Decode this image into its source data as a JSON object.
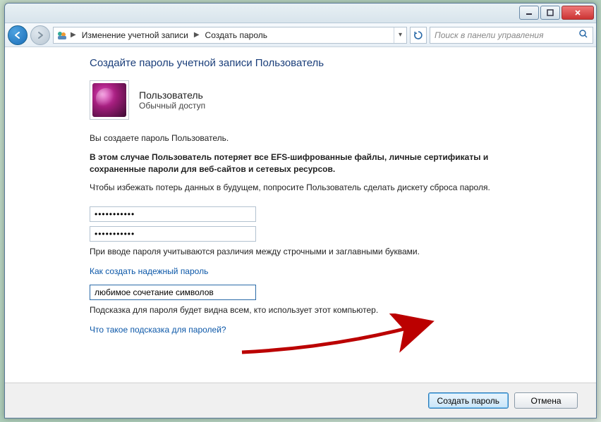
{
  "titlebar": {
    "minimize": "–",
    "maximize": "☐",
    "close": "✕"
  },
  "nav": {
    "breadcrumb1": "Изменение учетной записи",
    "breadcrumb2": "Создать пароль",
    "search_placeholder": "Поиск в панели управления"
  },
  "page": {
    "title": "Создайте пароль учетной записи Пользователь",
    "user_name": "Пользователь",
    "user_role": "Обычный доступ",
    "line1": "Вы создаете пароль Пользователь.",
    "warn": "В этом случае Пользователь потеряет все EFS-шифрованные файлы, личные сертификаты и сохраненные пароли для веб-сайтов и сетевых ресурсов.",
    "line2": "Чтобы избежать потерь данных в будущем, попросите Пользователь сделать дискету сброса пароля.",
    "pw1_value": "•••••••••••",
    "pw2_value": "•••••••••••",
    "note_case": "При вводе пароля учитываются различия между строчными и заглавными буквами.",
    "link_howto_pw": "Как создать надежный пароль",
    "hint_value": "любимое сочетание символов",
    "note_hint": "Подсказка для пароля будет видна всем, кто использует этот компьютер.",
    "link_whatis_hint": "Что такое подсказка для паролей?"
  },
  "footer": {
    "create": "Создать пароль",
    "cancel": "Отмена"
  }
}
